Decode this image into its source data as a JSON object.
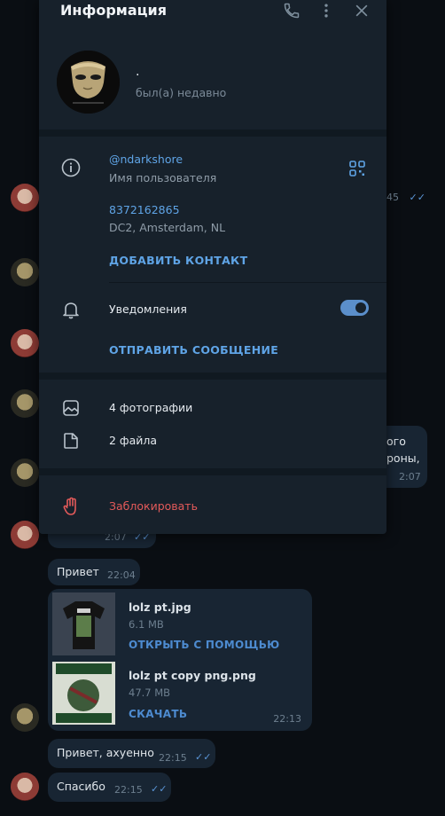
{
  "panel": {
    "title": "Информация",
    "header_icons": [
      "phone-icon",
      "more-vertical-icon",
      "close-icon"
    ],
    "profile": {
      "name": ".",
      "status": "был(а) недавно"
    },
    "username": {
      "value": "@ndarkshore",
      "caption": "Имя пользователя"
    },
    "phone": {
      "value": "8372162865",
      "caption": "DC2, Amsterdam, NL"
    },
    "add_contact_label": "ДОБАВИТЬ КОНТАКТ",
    "notifications": {
      "label": "Уведомления",
      "enabled": true
    },
    "send_message_label": "ОТПРАВИТЬ СООБЩЕНИЕ",
    "media": {
      "photos_label": "4 фотографии",
      "files_label": "2 файла"
    },
    "block_label": "Заблокировать",
    "colors": {
      "accent": "#5fa4e6",
      "danger": "#e35a5a",
      "panel_bg": "#17212b"
    }
  },
  "chat": {
    "partial_time_top": "45",
    "partial_text_1": "ого",
    "partial_text_2": "роны,",
    "partial_time_right": "2:07",
    "partial_time_left": "2:07",
    "messages": [
      {
        "text": "Привет",
        "time": "22:04"
      },
      {
        "text": "Привет, ахуенно",
        "time": "22:15"
      },
      {
        "text": "Спасибо",
        "time": "22:15"
      }
    ],
    "files": [
      {
        "name": "lolz pt.jpg",
        "size": "6.1 MB",
        "action": "ОТКРЫТЬ С ПОМОЩЬЮ"
      },
      {
        "name": "lolz pt copy png.png",
        "size": "47.7 MB",
        "action": "СКАЧАТЬ"
      }
    ],
    "files_time": "22:13"
  }
}
